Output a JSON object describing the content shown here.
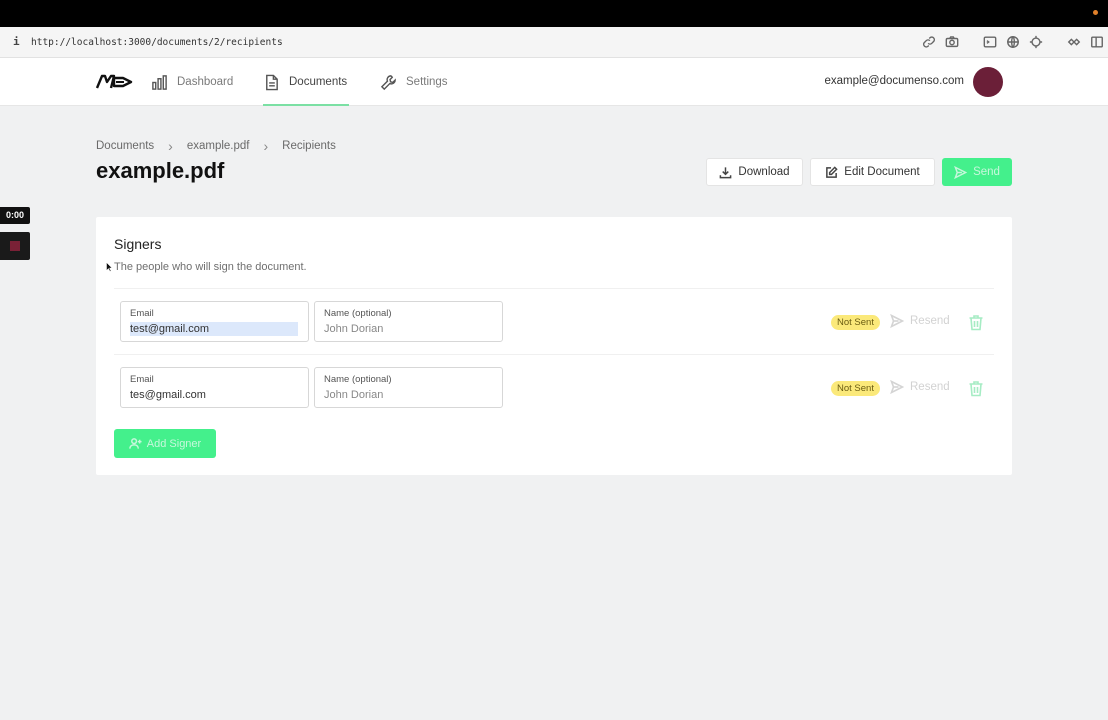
{
  "browser": {
    "info_glyph": "i",
    "url": "http://localhost:3000/documents/2/recipients",
    "tool_icons": [
      "link-icon",
      "camera-icon",
      "terminal-icon",
      "globe-icon",
      "crosshair-icon",
      "extension-icon",
      "sidebar-icon"
    ]
  },
  "nav": {
    "items": [
      {
        "label": "Dashboard",
        "icon": "chart-bars-icon"
      },
      {
        "label": "Documents",
        "icon": "document-icon"
      },
      {
        "label": "Settings",
        "icon": "wrench-icon"
      }
    ],
    "active": "Documents",
    "user_email": "example@documenso.com",
    "avatar_color": "#6b1f38"
  },
  "breadcrumb": [
    "Documents",
    "example.pdf",
    "Recipients"
  ],
  "page": {
    "title": "example.pdf",
    "actions": {
      "download": "Download",
      "edit": "Edit Document",
      "send": "Send"
    }
  },
  "recorder": {
    "time": "0:00"
  },
  "signers": {
    "title": "Signers",
    "subtitle": "The people who will sign the document.",
    "email_label": "Email",
    "name_label": "Name (optional)",
    "rows": [
      {
        "email": "test@gmail.com",
        "name_placeholder": "John Dorian",
        "status": "Not Sent",
        "resend": "Resend"
      },
      {
        "email": "tes@gmail.com",
        "name_placeholder": "John Dorian",
        "status": "Not Sent",
        "resend": "Resend"
      }
    ],
    "add_label": "Add Signer"
  },
  "colors": {
    "accent": "#44f08c",
    "status_badge": "#fbe97a",
    "background": "#f0f1f2"
  }
}
